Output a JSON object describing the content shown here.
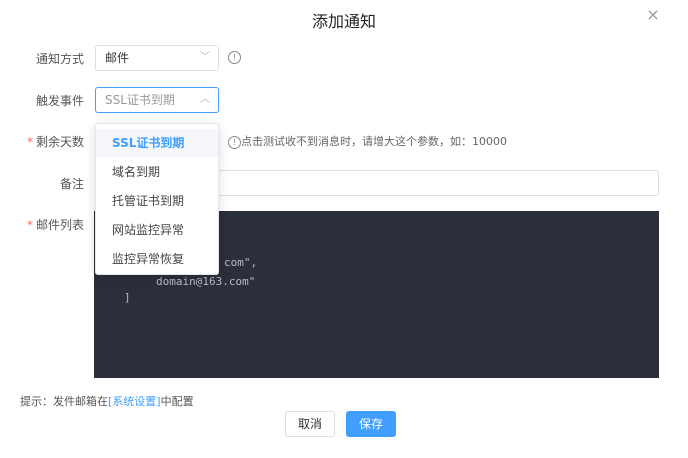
{
  "dialog": {
    "title": "添加通知"
  },
  "fields": {
    "method": {
      "label": "通知方式",
      "value": "邮件"
    },
    "trigger": {
      "label": "触发事件",
      "placeholder": "SSL证书到期"
    },
    "days": {
      "label": "剩余天数",
      "hint": "点击测试收不到消息时，请增大这个参数，如：10000"
    },
    "remark": {
      "label": "备注"
    },
    "email_list": {
      "label": "邮件列表"
    }
  },
  "dropdown": {
    "options": [
      "SSL证书到期",
      "域名到期",
      "托管证书到期",
      "网站监控异常",
      "监控异常恢复"
    ],
    "selected": "SSL证书到期"
  },
  "editor": {
    "lines": [
      "com\",",
      "domain@163.com\"",
      "]"
    ]
  },
  "footer": {
    "hint_prefix": "提示：发件邮箱在",
    "hint_link": "[系统设置]",
    "hint_suffix": "中配置",
    "cancel_label": "取消",
    "save_label": "保存"
  },
  "icons": {
    "close": "close-icon",
    "info": "info-icon",
    "chevron": "chevron-icon"
  },
  "colors": {
    "accent": "#409eff",
    "required": "#f56c6c",
    "editor_bg": "#2b2f3a"
  }
}
